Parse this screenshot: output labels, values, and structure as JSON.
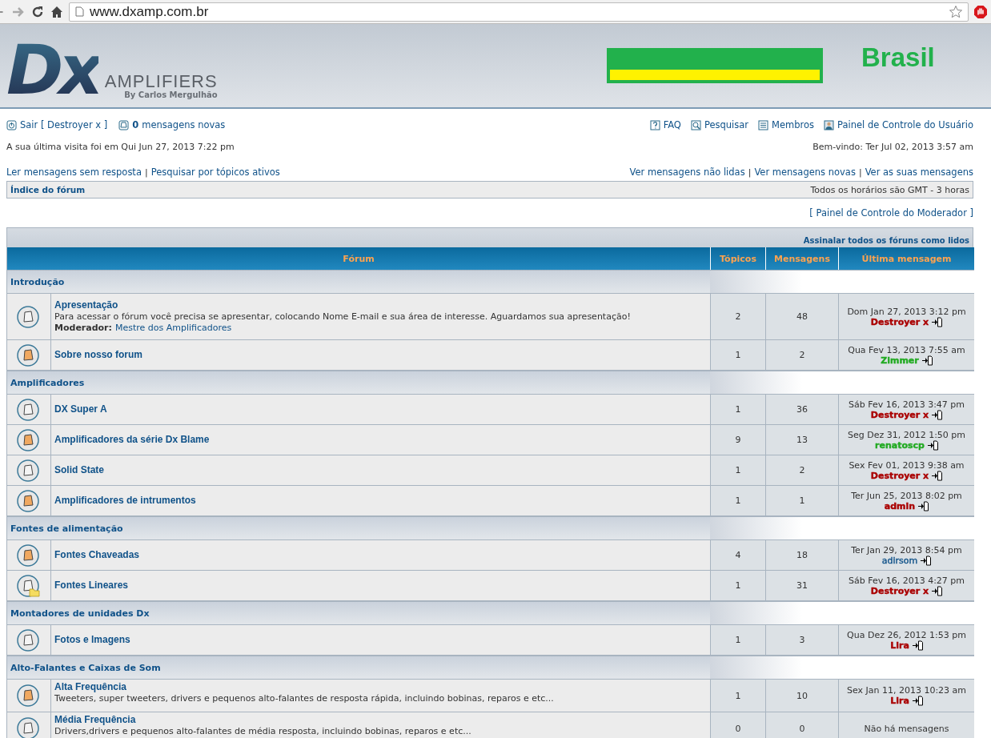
{
  "browser": {
    "url": "www.dxamp.com.br"
  },
  "header": {
    "logo_mark": "Dx",
    "logo_word": "AMPLIFIERS",
    "logo_byline": "By Carlos Mergulhão",
    "country": "Brasil"
  },
  "user_links": {
    "logout": "Sair [ Destroyer x ]",
    "new_count": "0",
    "new_label": "mensagens novas"
  },
  "nav_links": [
    "FAQ",
    "Pesquisar",
    "Membros",
    "Painel de Controle do Usuário"
  ],
  "link_separator": "|",
  "last_visit": "A sua última visita foi em Qui Jun 27, 2013 7:22 pm",
  "welcome": "Bem-vindo: Ter Jul 02, 2013 3:57 am",
  "left_links": [
    "Ler mensagens sem resposta",
    "Pesquisar por tópicos ativos"
  ],
  "right_links": [
    "Ver mensagens não lidas",
    "Ver mensagens novas",
    "Ver as suas mensagens"
  ],
  "breadcrumb": "Índice do fórum",
  "timezone": "Todos os horários são GMT - 3 horas",
  "moderator_panel": "[ Painel de Controle do Moderador ]",
  "mark_read": "Assinalar todos os fóruns como lidos",
  "columns": [
    "Fórum",
    "Tópicos",
    "Mensagens",
    "Última mensagem"
  ],
  "categories": [
    {
      "name": "Introdução",
      "forums": [
        {
          "name": "Apresentação",
          "kind": "read",
          "description": "Para acessar o fórum você precisa se apresentar, colocando Nome E-mail e sua área de interesse. Aguardamos sua apresentação!",
          "moderator_label": "Moderador:",
          "moderator": "Mestre dos Amplificadores",
          "topics": "2",
          "posts": "48",
          "last_post": {
            "date": "Dom Jan 27, 2013 3:12 pm",
            "author": "Destroyer x",
            "color": "#aa0000",
            "bold": true
          }
        },
        {
          "name": "Sobre nosso forum",
          "kind": "unread",
          "topics": "1",
          "posts": "2",
          "last_post": {
            "date": "Qua Fev 13, 2013 7:55 am",
            "author": "Zimmer",
            "color": "#22aa22",
            "bold": true
          }
        }
      ]
    },
    {
      "name": "Amplificadores",
      "forums": [
        {
          "name": "DX Super A",
          "kind": "read",
          "topics": "1",
          "posts": "36",
          "last_post": {
            "date": "Sáb Fev 16, 2013 3:47 pm",
            "author": "Destroyer x",
            "color": "#aa0000",
            "bold": true
          }
        },
        {
          "name": "Amplificadores da série Dx Blame",
          "kind": "unread",
          "topics": "9",
          "posts": "13",
          "last_post": {
            "date": "Seg Dez 31, 2012 1:50 pm",
            "author": "renatoscp",
            "color": "#22aa22",
            "bold": true
          }
        },
        {
          "name": "Solid State",
          "kind": "read",
          "topics": "1",
          "posts": "2",
          "last_post": {
            "date": "Sex Fev 01, 2013 9:38 am",
            "author": "Destroyer x",
            "color": "#aa0000",
            "bold": true
          }
        },
        {
          "name": "Amplificadores de intrumentos",
          "kind": "unread",
          "topics": "1",
          "posts": "1",
          "last_post": {
            "date": "Ter Jun 25, 2013 8:02 pm",
            "author": "admin",
            "color": "#aa0000",
            "bold": true
          }
        }
      ]
    },
    {
      "name": "Fontes de alimentação",
      "forums": [
        {
          "name": "Fontes Chaveadas",
          "kind": "unread",
          "topics": "4",
          "posts": "18",
          "last_post": {
            "date": "Ter Jan 29, 2013 8:54 pm",
            "author": "adirsom",
            "color": "#105289",
            "bold": false
          }
        },
        {
          "name": "Fontes Lineares",
          "kind": "subforum",
          "topics": "1",
          "posts": "31",
          "last_post": {
            "date": "Sáb Fev 16, 2013 4:27 pm",
            "author": "Destroyer x",
            "color": "#aa0000",
            "bold": true
          }
        }
      ]
    },
    {
      "name": "Montadores de unidades Dx",
      "forums": [
        {
          "name": "Fotos e Imagens",
          "kind": "read",
          "topics": "1",
          "posts": "3",
          "last_post": {
            "date": "Qua Dez 26, 2012 1:53 pm",
            "author": "Lira",
            "color": "#aa0000",
            "bold": true
          }
        }
      ]
    },
    {
      "name": "Alto-Falantes e Caixas de Som",
      "forums": [
        {
          "name": "Alta Frequência",
          "kind": "unread",
          "description": "Tweeters, super tweeters, drivers e pequenos alto-falantes de resposta rápida, incluindo bobinas, reparos e etc...",
          "topics": "1",
          "posts": "10",
          "last_post": {
            "date": "Sex Jan 11, 2013 10:23 am",
            "author": "Lira",
            "color": "#aa0000",
            "bold": true
          }
        },
        {
          "name": "Média Frequência",
          "kind": "read",
          "description": "Drivers,drivers e pequenos alto-falantes de média resposta, incluindo bobinas, reparos e etc...",
          "topics": "0",
          "posts": "0",
          "last_post": {
            "empty": "Não há mensagens"
          }
        }
      ]
    }
  ]
}
